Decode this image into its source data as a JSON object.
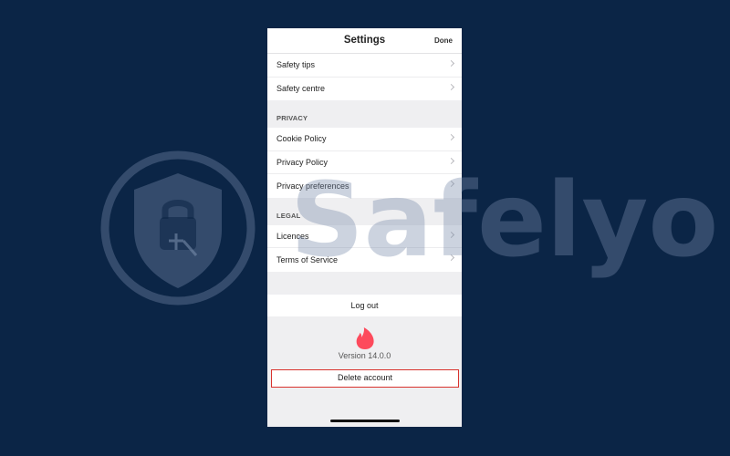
{
  "header": {
    "title": "Settings",
    "done_label": "Done"
  },
  "groups": {
    "safety": {
      "items": [
        "Safety tips",
        "Safety centre"
      ]
    },
    "privacy": {
      "label": "PRIVACY",
      "items": [
        "Cookie Policy",
        "Privacy Policy",
        "Privacy preferences"
      ]
    },
    "legal": {
      "label": "LEGAL",
      "items": [
        "Licences",
        "Terms of Service"
      ]
    }
  },
  "logout_label": "Log out",
  "brand": {
    "icon": "flame-icon",
    "version": "Version 14.0.0"
  },
  "delete_label": "Delete account",
  "watermark": {
    "text": "Safelyo",
    "icon": "shield-lock-icon"
  },
  "colors": {
    "background": "#0b2546",
    "highlight": "#d9332e",
    "flame": "#fd4a5c"
  }
}
